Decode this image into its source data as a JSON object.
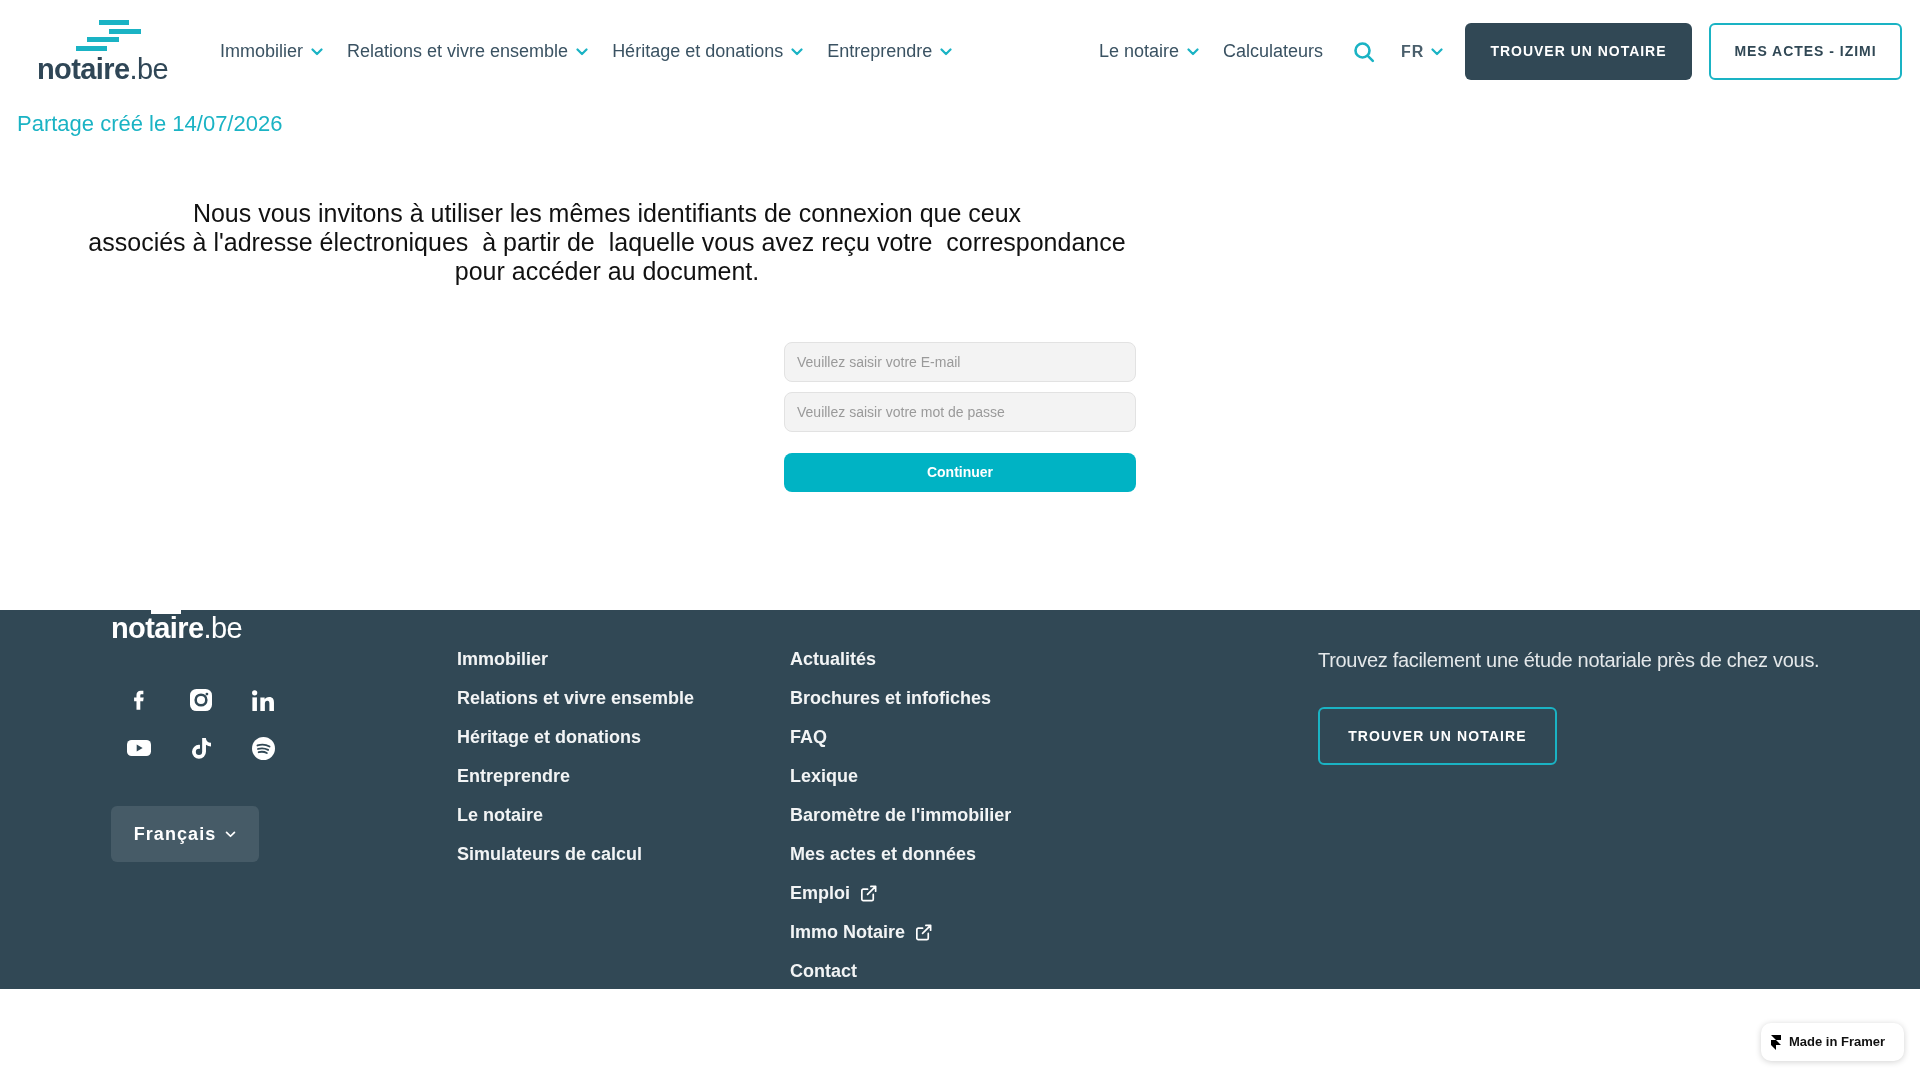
{
  "header": {
    "logo": {
      "name": "notaire",
      "suffix": ".be"
    },
    "nav": [
      {
        "label": "Immobilier",
        "dropdown": true
      },
      {
        "label": "Relations et vivre ensemble",
        "dropdown": true
      },
      {
        "label": "Héritage et donations",
        "dropdown": true
      },
      {
        "label": "Entreprendre",
        "dropdown": true
      }
    ],
    "secondary_nav": [
      {
        "label": "Le notaire",
        "dropdown": true
      },
      {
        "label": "Calculateurs",
        "dropdown": false
      }
    ],
    "language": {
      "label": "FR"
    },
    "buttons": [
      {
        "label": "TROUVER UN NOTAIRE",
        "kind": "filled"
      },
      {
        "label": "MES ACTES - IZIMI",
        "kind": "outline"
      }
    ]
  },
  "share_notice": "Partage créé le 14/07/2026",
  "login": {
    "message_lines": [
      "Nous vous invitons à utiliser les mêmes identifiants de connexion que ceux",
      "associés à l'adresse électroniques  à partir de  laquelle vous avez reçu votre  correspondance",
      "pour accéder au document."
    ],
    "email": {
      "placeholder": "Veuillez saisir votre E-mail"
    },
    "password": {
      "placeholder": "Veuillez saisir votre mot de passe"
    },
    "submit": "Continuer"
  },
  "footer": {
    "logo": {
      "name": "notaire",
      "suffix": ".be"
    },
    "social": [
      {
        "kind": "facebook"
      },
      {
        "kind": "instagram"
      },
      {
        "kind": "linkedin"
      },
      {
        "kind": "youtube"
      },
      {
        "kind": "tiktok"
      },
      {
        "kind": "spotify"
      }
    ],
    "language_select": "Français",
    "link_columns": [
      [
        {
          "label": "Immobilier",
          "external": false
        },
        {
          "label": "Relations et vivre ensemble",
          "external": false
        },
        {
          "label": "Héritage et donations",
          "external": false
        },
        {
          "label": "Entreprendre",
          "external": false
        },
        {
          "label": "Le notaire",
          "external": false
        },
        {
          "label": "Simulateurs de calcul",
          "external": false
        }
      ],
      [
        {
          "label": "Actualités",
          "external": false
        },
        {
          "label": "Brochures et infofiches",
          "external": false
        },
        {
          "label": "FAQ",
          "external": false
        },
        {
          "label": "Lexique",
          "external": false
        },
        {
          "label": "Baromètre de l'immobilier",
          "external": false
        },
        {
          "label": "Mes actes et données",
          "external": false
        },
        {
          "label": "Emploi",
          "external": true
        },
        {
          "label": "Immo Notaire",
          "external": true
        },
        {
          "label": "Contact",
          "external": false
        }
      ]
    ],
    "cta": {
      "text": "Trouvez facilement une étude notariale près de chez vous.",
      "button": "TROUVER UN NOTAIRE"
    }
  },
  "badge": {
    "label": "Made in Framer"
  }
}
